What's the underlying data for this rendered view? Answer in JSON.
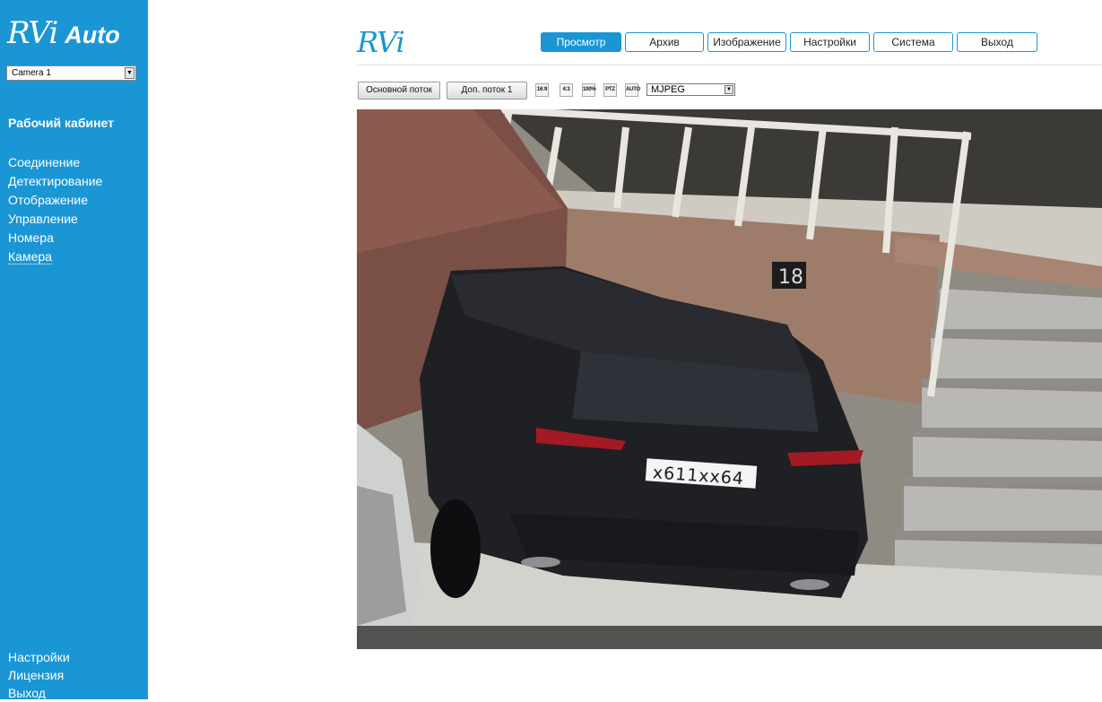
{
  "sidebar": {
    "logo_brand": "RVi",
    "logo_suffix": "Auto",
    "camera_select": {
      "value": "Camera 1"
    },
    "section_title": "Рабочий кабинет",
    "menu": [
      {
        "label": "Соединение"
      },
      {
        "label": "Детектирование"
      },
      {
        "label": "Отображение"
      },
      {
        "label": "Управление"
      },
      {
        "label": "Номера"
      },
      {
        "label": "Камера"
      }
    ],
    "bottom_menu": [
      {
        "label": "Настройки"
      },
      {
        "label": "Лицензия"
      },
      {
        "label": "Выход"
      }
    ]
  },
  "header": {
    "logo": "RVi",
    "nav": [
      {
        "label": "Просмотр"
      },
      {
        "label": "Архив"
      },
      {
        "label": "Изображение"
      },
      {
        "label": "Настройки"
      },
      {
        "label": "Система"
      },
      {
        "label": "Выход"
      }
    ],
    "active_tab": "Просмотр"
  },
  "toolbar": {
    "main_stream": "Основной поток",
    "sub_stream": "Доп. поток 1",
    "icons": {
      "ratio_169": "16:9",
      "ratio_43": "4:3",
      "zoom_100": "100%",
      "ptz": "PTZ",
      "auto": "AUTO"
    },
    "codec_select": {
      "value": "MJPEG"
    }
  },
  "video": {
    "plate_text": "x611xx64"
  },
  "colors": {
    "accent": "#1a96d4",
    "video_bar": "#505350"
  }
}
